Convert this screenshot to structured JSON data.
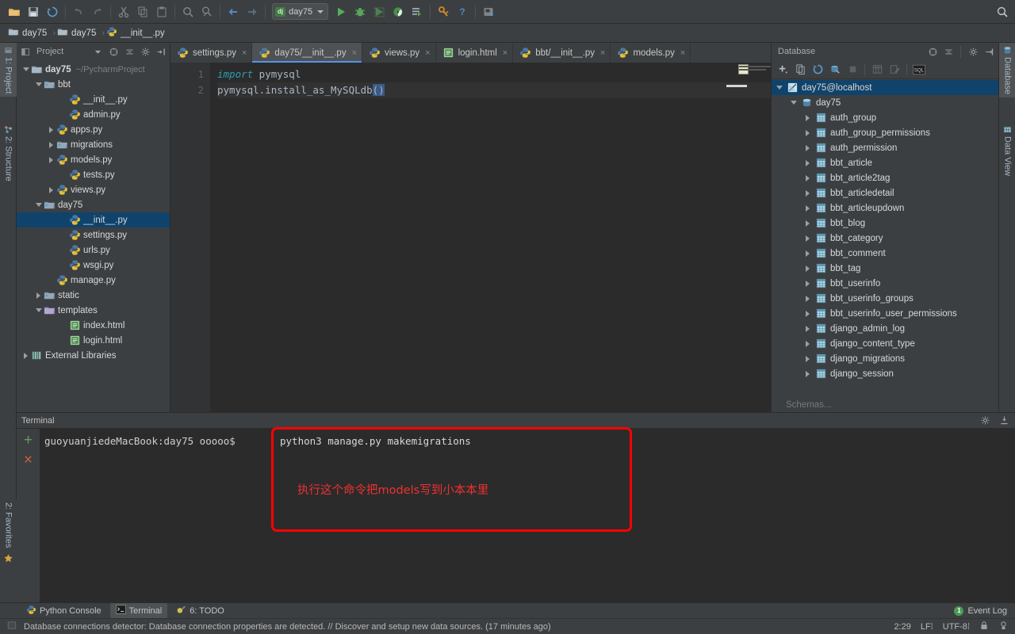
{
  "toolbar": {
    "icons": [
      {
        "name": "open-folder-icon",
        "glyph": "folder"
      },
      {
        "name": "save-all-icon",
        "glyph": "save"
      },
      {
        "name": "sync-icon",
        "glyph": "sync"
      },
      {
        "name": "undo-icon",
        "glyph": "undo"
      },
      {
        "name": "redo-icon",
        "glyph": "redo"
      },
      {
        "name": "cut-icon",
        "glyph": "cut"
      },
      {
        "name": "copy-icon",
        "glyph": "copy"
      },
      {
        "name": "paste-icon",
        "glyph": "paste"
      },
      {
        "name": "find-icon",
        "glyph": "find"
      },
      {
        "name": "find-replace-icon",
        "glyph": "findreplace"
      },
      {
        "name": "back-icon",
        "glyph": "back"
      },
      {
        "name": "forward-icon",
        "glyph": "forward"
      }
    ],
    "run_config": {
      "badge": "dj",
      "label": "day75"
    },
    "run_label": "Run",
    "debug_label": "Debug",
    "coverage_label": "Run with Coverage",
    "profile_label": "Profile",
    "attach_label": "Attach",
    "settings_label": "Settings",
    "help_label": "Help",
    "updates_label": "Updates",
    "search_everywhere_label": "Search Everywhere"
  },
  "breadcrumb": [
    {
      "label": "day75",
      "icon": "folder-icon"
    },
    {
      "label": "day75",
      "icon": "folder-icon"
    },
    {
      "label": "__init__.py",
      "icon": "python-file-icon"
    }
  ],
  "left_strip": {
    "project_tab": "1: Project",
    "structure_tab": "2: Structure",
    "favorites_tab": "2: Favorites"
  },
  "right_strip": {
    "database_tab": "Database",
    "data_view_tab": "Data View"
  },
  "project": {
    "title": "Project",
    "tree": [
      {
        "indent": 0,
        "twisty": "expanded",
        "icon": "folder-icon",
        "label": "day75",
        "bold": true,
        "sub": "~/PycharmProject",
        "selected": false
      },
      {
        "indent": 1,
        "twisty": "expanded",
        "icon": "module-folder-icon",
        "label": "bbt",
        "bold": false,
        "sub": "",
        "selected": false
      },
      {
        "indent": 3,
        "twisty": "none",
        "icon": "python-file-icon",
        "label": "__init__.py",
        "bold": false,
        "sub": "",
        "selected": false
      },
      {
        "indent": 3,
        "twisty": "none",
        "icon": "python-file-icon",
        "label": "admin.py",
        "bold": false,
        "sub": "",
        "selected": false
      },
      {
        "indent": 2,
        "twisty": "collapsed",
        "icon": "python-file-icon",
        "label": "apps.py",
        "bold": false,
        "sub": "",
        "selected": false
      },
      {
        "indent": 2,
        "twisty": "collapsed",
        "icon": "module-folder-icon",
        "label": "migrations",
        "bold": false,
        "sub": "",
        "selected": false
      },
      {
        "indent": 2,
        "twisty": "collapsed",
        "icon": "python-file-icon",
        "label": "models.py",
        "bold": false,
        "sub": "",
        "selected": false
      },
      {
        "indent": 3,
        "twisty": "none",
        "icon": "python-file-icon",
        "label": "tests.py",
        "bold": false,
        "sub": "",
        "selected": false
      },
      {
        "indent": 2,
        "twisty": "collapsed",
        "icon": "python-file-icon",
        "label": "views.py",
        "bold": false,
        "sub": "",
        "selected": false
      },
      {
        "indent": 1,
        "twisty": "expanded",
        "icon": "module-folder-icon",
        "label": "day75",
        "bold": false,
        "sub": "",
        "selected": false
      },
      {
        "indent": 3,
        "twisty": "none",
        "icon": "python-file-icon",
        "label": "__init__.py",
        "bold": false,
        "sub": "",
        "selected": true
      },
      {
        "indent": 3,
        "twisty": "none",
        "icon": "python-file-icon",
        "label": "settings.py",
        "bold": false,
        "sub": "",
        "selected": false
      },
      {
        "indent": 3,
        "twisty": "none",
        "icon": "python-file-icon",
        "label": "urls.py",
        "bold": false,
        "sub": "",
        "selected": false
      },
      {
        "indent": 3,
        "twisty": "none",
        "icon": "python-file-icon",
        "label": "wsgi.py",
        "bold": false,
        "sub": "",
        "selected": false
      },
      {
        "indent": 2,
        "twisty": "none",
        "icon": "python-file-icon",
        "label": "manage.py",
        "bold": false,
        "sub": "",
        "selected": false
      },
      {
        "indent": 1,
        "twisty": "collapsed",
        "icon": "module-folder-icon",
        "label": "static",
        "bold": false,
        "sub": "",
        "selected": false
      },
      {
        "indent": 1,
        "twisty": "expanded",
        "icon": "templates-folder-icon",
        "label": "templates",
        "bold": false,
        "sub": "",
        "selected": false
      },
      {
        "indent": 3,
        "twisty": "none",
        "icon": "html-file-icon",
        "label": "index.html",
        "bold": false,
        "sub": "",
        "selected": false
      },
      {
        "indent": 3,
        "twisty": "none",
        "icon": "html-file-icon",
        "label": "login.html",
        "bold": false,
        "sub": "",
        "selected": false
      },
      {
        "indent": 0,
        "twisty": "collapsed",
        "icon": "library-icon",
        "label": "External Libraries",
        "bold": false,
        "sub": "",
        "selected": false
      }
    ]
  },
  "editor": {
    "tabs": [
      {
        "label": "settings.py",
        "icon": "python-file-icon",
        "active": false
      },
      {
        "label": "day75/__init__.py",
        "icon": "python-file-icon",
        "active": true
      },
      {
        "label": "views.py",
        "icon": "python-file-icon",
        "active": false
      },
      {
        "label": "login.html",
        "icon": "html-file-icon",
        "active": false
      },
      {
        "label": "bbt/__init__.py",
        "icon": "python-file-icon",
        "active": false
      },
      {
        "label": "models.py",
        "icon": "python-file-icon",
        "active": false
      }
    ],
    "close_glyph": "×",
    "line_numbers": [
      "1",
      "2"
    ],
    "code": {
      "line1_keyword": "import",
      "line1_rest": " pymysql",
      "line2_a": "pymysql.install_as_MySQLdb",
      "line2_parens": "()"
    }
  },
  "database": {
    "title": "Database",
    "toolbar_icons": [
      {
        "name": "add-data-source-icon"
      },
      {
        "name": "duplicate-icon"
      },
      {
        "name": "refresh-icon"
      },
      {
        "name": "sync-data-source-icon"
      },
      {
        "name": "stop-icon"
      },
      {
        "name": "table-editor-icon"
      },
      {
        "name": "modify-table-icon"
      },
      {
        "name": "sql-console-icon"
      }
    ],
    "tree": [
      {
        "indent": 0,
        "twisty": "expanded",
        "icon": "datasource-icon",
        "label": "day75@localhost",
        "selected": true
      },
      {
        "indent": 1,
        "twisty": "expanded",
        "icon": "schema-icon",
        "label": "day75",
        "selected": false
      },
      {
        "indent": 2,
        "twisty": "collapsed",
        "icon": "table-icon",
        "label": "auth_group",
        "selected": false
      },
      {
        "indent": 2,
        "twisty": "collapsed",
        "icon": "table-icon",
        "label": "auth_group_permissions",
        "selected": false
      },
      {
        "indent": 2,
        "twisty": "collapsed",
        "icon": "table-icon",
        "label": "auth_permission",
        "selected": false
      },
      {
        "indent": 2,
        "twisty": "collapsed",
        "icon": "table-icon",
        "label": "bbt_article",
        "selected": false
      },
      {
        "indent": 2,
        "twisty": "collapsed",
        "icon": "table-icon",
        "label": "bbt_article2tag",
        "selected": false
      },
      {
        "indent": 2,
        "twisty": "collapsed",
        "icon": "table-icon",
        "label": "bbt_articledetail",
        "selected": false
      },
      {
        "indent": 2,
        "twisty": "collapsed",
        "icon": "table-icon",
        "label": "bbt_articleupdown",
        "selected": false
      },
      {
        "indent": 2,
        "twisty": "collapsed",
        "icon": "table-icon",
        "label": "bbt_blog",
        "selected": false
      },
      {
        "indent": 2,
        "twisty": "collapsed",
        "icon": "table-icon",
        "label": "bbt_category",
        "selected": false
      },
      {
        "indent": 2,
        "twisty": "collapsed",
        "icon": "table-icon",
        "label": "bbt_comment",
        "selected": false
      },
      {
        "indent": 2,
        "twisty": "collapsed",
        "icon": "table-icon",
        "label": "bbt_tag",
        "selected": false
      },
      {
        "indent": 2,
        "twisty": "collapsed",
        "icon": "table-icon",
        "label": "bbt_userinfo",
        "selected": false
      },
      {
        "indent": 2,
        "twisty": "collapsed",
        "icon": "table-icon",
        "label": "bbt_userinfo_groups",
        "selected": false
      },
      {
        "indent": 2,
        "twisty": "collapsed",
        "icon": "table-icon",
        "label": "bbt_userinfo_user_permissions",
        "selected": false
      },
      {
        "indent": 2,
        "twisty": "collapsed",
        "icon": "table-icon",
        "label": "django_admin_log",
        "selected": false
      },
      {
        "indent": 2,
        "twisty": "collapsed",
        "icon": "table-icon",
        "label": "django_content_type",
        "selected": false
      },
      {
        "indent": 2,
        "twisty": "collapsed",
        "icon": "table-icon",
        "label": "django_migrations",
        "selected": false
      },
      {
        "indent": 2,
        "twisty": "collapsed",
        "icon": "table-icon",
        "label": "django_session",
        "selected": false
      }
    ],
    "schemas_label": "Schemas..."
  },
  "terminal": {
    "title": "Terminal",
    "new_session_label": "+",
    "close_session_label": "×",
    "prompt": "guoyuanjiedeMacBook:day75 ooooo$",
    "command": "python3 manage.py makemigrations",
    "annotation": "执行这个命令把models写到小本本里",
    "annotation_color": "#ff0000"
  },
  "bottom_tabs": [
    {
      "label": "Python Console",
      "icon": "python-console-icon",
      "active": false
    },
    {
      "label": "Terminal",
      "icon": "terminal-icon",
      "active": true
    },
    {
      "label": "6: TODO",
      "icon": "todo-icon",
      "active": false
    }
  ],
  "event_log": {
    "count": "1",
    "label": "Event Log"
  },
  "status": {
    "message": "Database connections detector: Database connection properties are detected. // Discover and setup new data sources. (17 minutes ago)",
    "caret": "2:29",
    "line_sep": "LF",
    "encoding": "UTF-8",
    "lock_icon": "lock-icon",
    "inspector_icon": "inspection-icon"
  },
  "colors": {
    "panel_bg": "#3c3f41",
    "editor_bg": "#2b2b2b",
    "selection_blue": "#10436b",
    "accent_blue": "#5394ec",
    "annotation_red": "#ff0000",
    "keyword_orange": "#cc7832",
    "code_text": "#a9b7c6"
  }
}
